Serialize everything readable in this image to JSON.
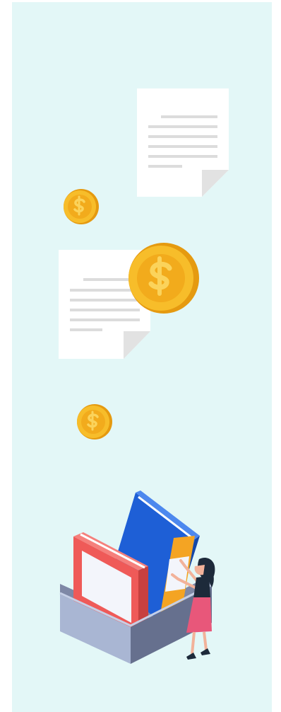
{
  "illustration": {
    "subject": "finance-documents-illustration",
    "colors": {
      "background": "#e3f7f7",
      "paper": "#ffffff",
      "paper_fold": "#e2e2e2",
      "text_lines": "#dcdcdc",
      "coin": "#f7bd2a",
      "coin_edge": "#e59a10",
      "coin_symbol": "#e8a215",
      "binder_blue": "#1e5fd6",
      "binder_red": "#ef5a58",
      "binder_orange": "#f4a423",
      "box_front": "#a9b6d3",
      "box_side": "#66708e",
      "woman_skirt": "#e8577a",
      "woman_hair": "#1d2a3a"
    },
    "icons": [
      "document-icon",
      "coin-icon",
      "binder-icon",
      "file-box-icon",
      "woman-figure-icon"
    ]
  }
}
